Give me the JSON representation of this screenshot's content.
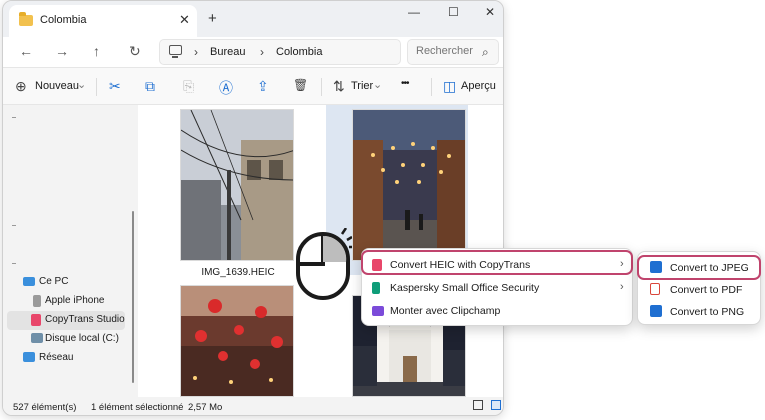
{
  "window": {
    "tab_title": "Colombia",
    "tab_close": "✕",
    "new_tab": "+",
    "controls": [
      "—",
      "☐",
      "✕"
    ]
  },
  "nav": {
    "back": "←",
    "forward": "→",
    "up": "↑",
    "refresh": "↻",
    "breadcrumb": [
      "Bureau",
      "Colombia"
    ],
    "breadcrumb_sep": "›",
    "search_placeholder": "Rechercher",
    "search_icon": "⌕"
  },
  "toolbar": {
    "new_label": "Nouveau",
    "new_icon": "⊕",
    "new_caret": "⌄",
    "icons": [
      "cut-icon",
      "copy-icon",
      "paste-icon",
      "rename-icon",
      "share-icon",
      "delete-icon"
    ],
    "cut_glyph": "✂",
    "copy_glyph": "⧉",
    "paste_glyph": "⎘",
    "rename_glyph": "Ⓐ",
    "share_glyph": "⇪",
    "delete_glyph": "🗑",
    "sort_glyph": "⇅",
    "sort_label": "Trier",
    "sort_caret": "⌄",
    "more_glyph": "•••",
    "preview_glyph": "◫",
    "preview_label": "Aperçu"
  },
  "sidebar": {
    "items": [
      {
        "label": "Ce PC",
        "icon": "monitor-icon"
      },
      {
        "label": "Apple iPhone",
        "icon": "iphone-icon"
      },
      {
        "label": "CopyTrans Studio",
        "icon": "copytrans-icon",
        "selected": true
      },
      {
        "label": "Disque local (C:)",
        "icon": "drive-icon"
      },
      {
        "label": "Réseau",
        "icon": "network-icon"
      }
    ]
  },
  "files": {
    "selected_caption": "IMG_1639.HEIC"
  },
  "status": {
    "count": "527 élément(s)",
    "selection": "1 élément sélectionné",
    "size": "2,57 Mo"
  },
  "context_menu": {
    "items": [
      {
        "label": "Convert HEIC with CopyTrans",
        "icon": "copytrans-icon",
        "has_submenu": true,
        "highlighted": true
      },
      {
        "label": "Kaspersky Small Office Security",
        "icon": "kaspersky-icon",
        "has_submenu": true
      },
      {
        "label": "Monter avec Clipchamp",
        "icon": "clipchamp-icon",
        "has_submenu": false
      }
    ],
    "chevron": "›"
  },
  "submenu": {
    "items": [
      {
        "label": "Convert to JPEG",
        "icon": "image-icon",
        "highlighted": true
      },
      {
        "label": "Convert to PDF",
        "icon": "pdf-icon"
      },
      {
        "label": "Convert to PNG",
        "icon": "image-icon"
      }
    ]
  },
  "colors": {
    "highlight_border": "#c0446d",
    "accent": "#1f6fd1",
    "copytrans": "#e8466a",
    "kaspersky": "#0f9d79",
    "clipchamp": "#7b4bd9"
  }
}
